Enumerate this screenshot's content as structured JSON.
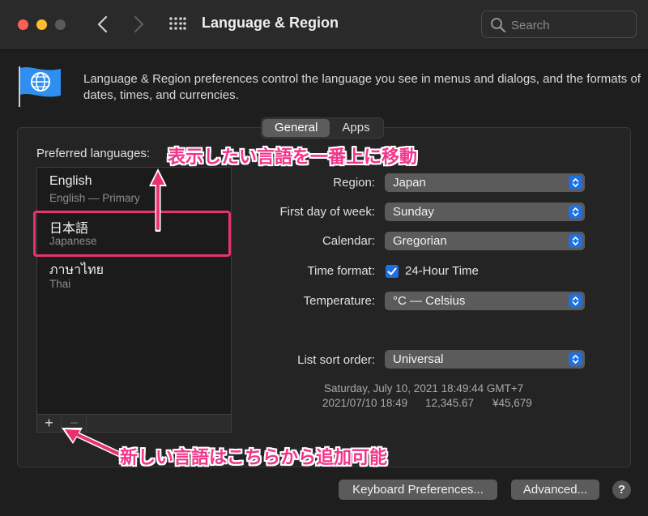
{
  "window": {
    "title": "Language & Region",
    "search_placeholder": "Search"
  },
  "header": {
    "description": "Language & Region preferences control the language you see in menus and dialogs, and the formats of dates, times, and currencies."
  },
  "tabs": [
    {
      "label": "General",
      "active": true
    },
    {
      "label": "Apps",
      "active": false
    }
  ],
  "preferred_languages": {
    "label": "Preferred languages:",
    "items": [
      {
        "name": "English",
        "sub": "English — Primary"
      },
      {
        "name": "日本語",
        "sub": "Japanese"
      },
      {
        "name": "ภาษาไทย",
        "sub": "Thai"
      }
    ],
    "add_label": "+",
    "remove_label": "−"
  },
  "settings": {
    "region_label": "Region:",
    "region_value": "Japan",
    "first_day_label": "First day of week:",
    "first_day_value": "Sunday",
    "calendar_label": "Calendar:",
    "calendar_value": "Gregorian",
    "time_format_label": "Time format:",
    "time_format_value": "24-Hour Time",
    "time_format_checked": true,
    "temperature_label": "Temperature:",
    "temperature_value": "°C — Celsius",
    "sort_order_label": "List sort order:",
    "sort_order_value": "Universal"
  },
  "sample": {
    "date_line": "Saturday, July 10, 2021 18:49:44 GMT+7",
    "short_date": "2021/07/10 18:49",
    "number": "12,345.67",
    "currency": "¥45,679"
  },
  "buttons": {
    "keyboard": "Keyboard Preferences...",
    "advanced": "Advanced...",
    "help": "?"
  },
  "annotations": {
    "top": "表示したい言語を一番上に移動",
    "bottom": "新しい言語はこちらから追加可能",
    "color": "#f2358a"
  },
  "colors": {
    "accent": "#1f6fe0",
    "close": "#ff5f57",
    "minimize": "#febc2e"
  }
}
